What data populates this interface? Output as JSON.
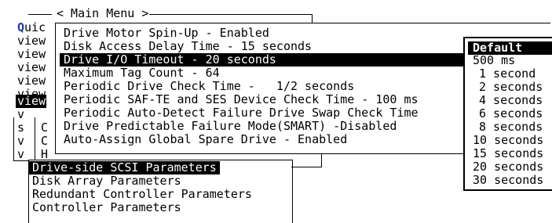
{
  "main_menu": {
    "title": "< Main Menu >",
    "first_item_prefix": "Q",
    "first_item_rest": "uic",
    "left_items": [
      "view",
      "view",
      "view",
      "view",
      "view",
      "view",
      "v",
      "s",
      "v",
      "v"
    ],
    "left_second_col": [
      "C",
      "C",
      "H"
    ]
  },
  "drive_params": {
    "items": [
      "Drive Motor Spin-Up - Enabled",
      "Disk Access Delay Time - 15 seconds",
      "Drive I/O Timeout - 20 seconds",
      "Maximum Tag Count - 64",
      "Periodic Drive Check Time -   1/2 seconds",
      "Periodic SAF-TE and SES Device Check Time - 100 ms",
      "Periodic Auto-Detect Failure Drive Swap Check Time",
      "Drive Predictable Failure Mode(SMART) -Disabled",
      "Auto-Assign Global Spare Drive - Enabled"
    ],
    "selected_index": 2
  },
  "config_params": {
    "items": [
      "Drive-side SCSI Parameters",
      "Disk Array Parameters",
      "Redundant Controller Parameters",
      "Controller Parameters"
    ],
    "selected_index": 0
  },
  "timeout_options": {
    "items": [
      "Default",
      "500 ms",
      "1 second",
      "2 seconds",
      "4 seconds",
      "6 seconds",
      "8 seconds",
      "10 seconds",
      "15 seconds",
      "20 seconds",
      "30 seconds"
    ],
    "selected_index": 0
  }
}
